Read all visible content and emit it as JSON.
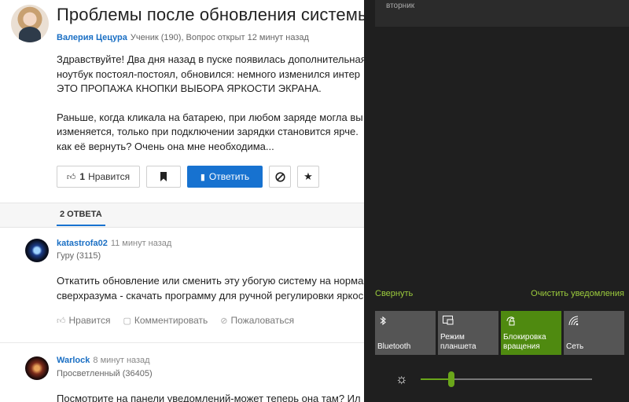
{
  "question": {
    "title": "Проблемы после обновления системы Windows",
    "author": "Валерия Цецура",
    "meta": "Ученик (190), Вопрос открыт 12 минут назад",
    "paragraphs": [
      [
        "Здравствуйте! Два дня назад в пуске появилась дополнительная",
        "ноутбук постоял-постоял, обновился: немного изменился интер",
        "ЭТО ПРОПАЖА КНОПКИ ВЫБОРА ЯРКОСТИ ЭКРАНА."
      ],
      [
        "Раньше, когда кликала на батарею, при любом заряде могла вы",
        "изменяется, только при подключении зарядки становится ярче.",
        "как её вернуть? Очень она мне необходима..."
      ]
    ],
    "buttons": {
      "like_count": "1",
      "like_label": "Нравится",
      "answer_label": "Ответить"
    },
    "icons": {
      "like": "thumbs-up-icon",
      "bookmark": "bookmark-icon",
      "answer": "reply-icon",
      "block": "block-icon",
      "star": "star-icon"
    }
  },
  "answers_tab": "2 ОТВЕТА",
  "answers": [
    {
      "name": "katastrofa02",
      "time": "11 минут назад",
      "rank": "Гуру (3115)",
      "lines": [
        "Откатить обновление или сменить эту убогую систему на норма",
        "сверхразума - скачать программу для ручной регулировки яркос"
      ],
      "actions": [
        "Нравится",
        "Комментировать",
        "Пожаловаться"
      ]
    },
    {
      "name": "Warlock",
      "time": "8 минут назад",
      "rank": "Просветленный (36405)",
      "lines": [
        "Посмотрите на панели уведомлений-может теперь она там? Ил"
      ]
    }
  ],
  "action_center": {
    "notification_text": "вторник",
    "collapse": "Свернуть",
    "clear": "Очистить уведомления",
    "tiles": [
      {
        "label": "Bluetooth",
        "icon": "bluetooth-icon",
        "active": false
      },
      {
        "label": "Режим планшета",
        "icon": "tablet-mode-icon",
        "active": false
      },
      {
        "label": "Блокировка вращения",
        "icon": "rotation-lock-icon",
        "active": true
      },
      {
        "label": "Сеть",
        "icon": "network-icon",
        "active": false
      }
    ],
    "brightness_level": 0.18,
    "colors": {
      "accent": "#4f8a10",
      "link": "#9ccc3d",
      "panel": "#1f1f1f",
      "tile": "#555555"
    }
  }
}
